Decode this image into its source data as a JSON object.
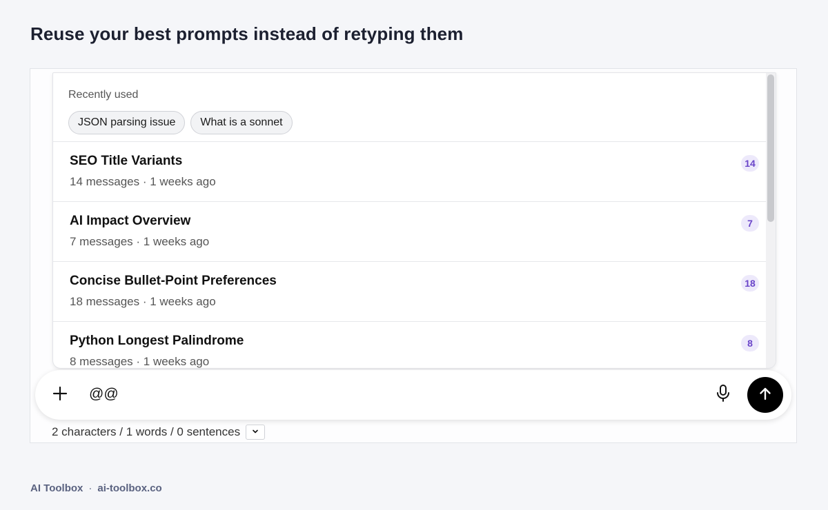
{
  "page": {
    "heading": "Reuse your best prompts instead of retyping them"
  },
  "recent": {
    "label": "Recently used",
    "chips": [
      "JSON parsing issue",
      "What is a sonnet"
    ]
  },
  "conversations": [
    {
      "title": "SEO Title Variants",
      "meta": "14 messages · 1 weeks ago",
      "count": "14"
    },
    {
      "title": "AI Impact Overview",
      "meta": "7 messages · 1 weeks ago",
      "count": "7"
    },
    {
      "title": "Concise Bullet-Point Preferences",
      "meta": "18 messages · 1 weeks ago",
      "count": "18"
    },
    {
      "title": "Python Longest Palindrome",
      "meta": "8 messages · 1 weeks ago",
      "count": "8"
    }
  ],
  "composer": {
    "value": "@@",
    "icons": {
      "add": "plus-icon",
      "mic": "microphone-icon",
      "send": "arrow-up-icon",
      "toggle": "chevron-down-icon"
    }
  },
  "stats": {
    "text": "2 characters / 1 words / 0 sentences"
  },
  "footer": {
    "brand": "AI Toolbox",
    "separator": "·",
    "url": "ai-toolbox.co"
  },
  "colors": {
    "badge_bg": "#ede9fb",
    "badge_text": "#6a45c9",
    "send_button": "#000000"
  }
}
